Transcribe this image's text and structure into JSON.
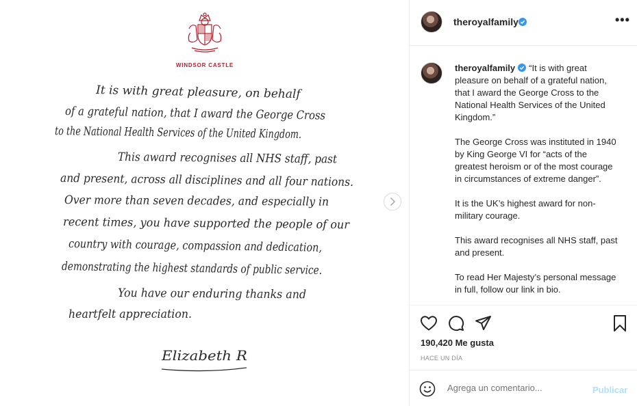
{
  "letter": {
    "castle_label": "WINDSOR CASTLE",
    "handwritten_lines": [
      "It is with great pleasure, on behalf",
      "of a grateful nation, that I award the George Cross",
      "to the National Health Services of the United Kingdom.",
      "This award recognises all NHS staff, past",
      "and present, across all disciplines and all four nations.",
      "Over more than seven decades, and especially in",
      "recent times, you have supported the people of our",
      "country with courage, compassion and dedication,",
      "demonstrating the highest standards of public service.",
      "You have our enduring thanks and",
      "heartfelt appreciation."
    ],
    "signature": "Elizabeth R"
  },
  "header": {
    "username": "theroyalfamily",
    "more_label": "•••"
  },
  "caption": {
    "username": "theroyalfamily",
    "paragraphs": [
      "“It is with great pleasure on behalf of a grateful nation, that I award the George Cross to the National Health Services of the United Kingdom.”",
      "The George Cross was instituted in 1940 by King George VI for “acts of the greatest heroism or of the most courage in circumstances of extreme danger”.",
      "It is the UK’s highest award for non-military courage.",
      "This award recognises all NHS staff, past and present.",
      "To read Her Majesty’s personal message in full, follow our link in bio."
    ]
  },
  "stats": {
    "likes": "190,420 Me gusta",
    "time": "HACE UN DÍA"
  },
  "comment": {
    "placeholder": "Agrega un comentario...",
    "publish_label": "Publicar"
  },
  "colors": {
    "accent_red": "#b0202e",
    "verified_blue": "#3897f0",
    "publish_disabled": "#b2dffc"
  }
}
